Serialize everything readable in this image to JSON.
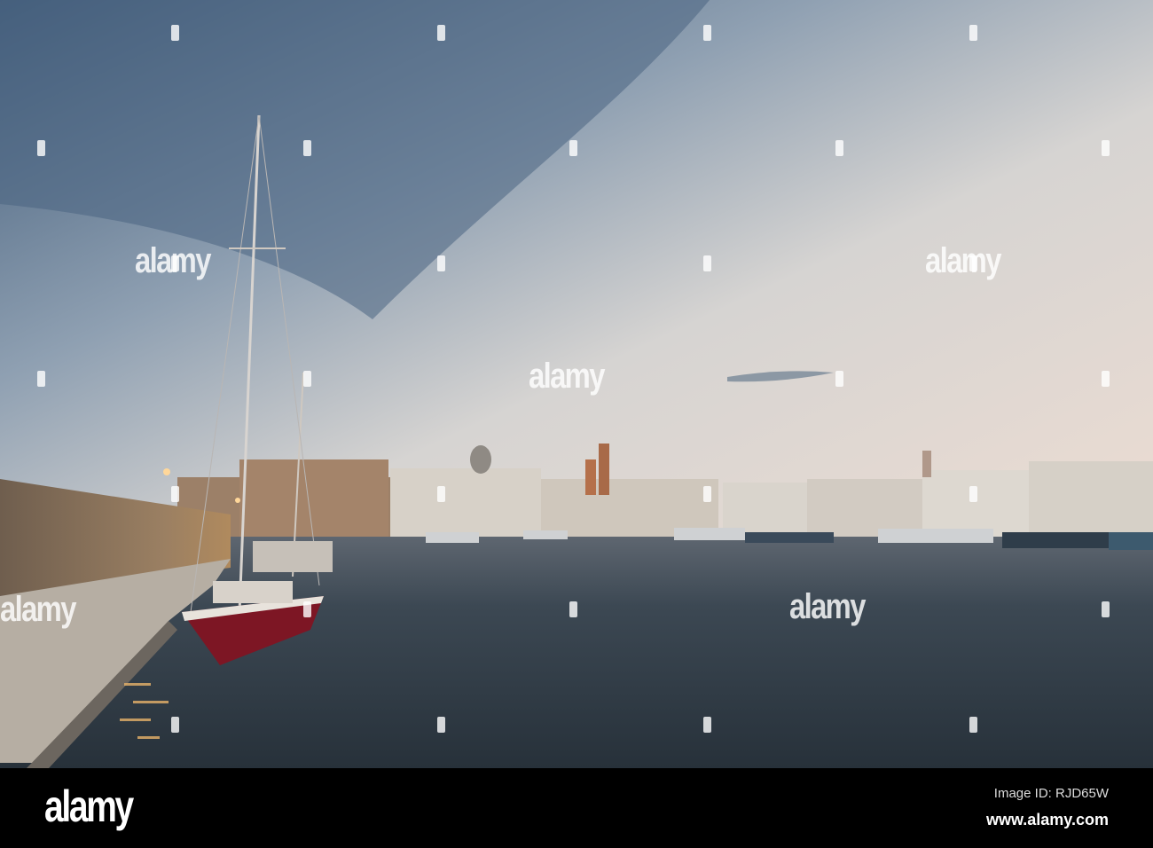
{
  "photo": {
    "subject": "Harbour at dusk with moored sailboat and whitewashed town",
    "colors": {
      "sky_top": "#4d6885",
      "sky_light": "#d9d6d2",
      "horizon": "#e8d6cc",
      "water": "#36424d",
      "hull": "#7d1624",
      "quay": "#8c7763"
    }
  },
  "watermark": {
    "text": "alamy"
  },
  "footer": {
    "logo": "alamy",
    "image_id": "Image ID: RJD65W",
    "website": "www.alamy.com"
  }
}
